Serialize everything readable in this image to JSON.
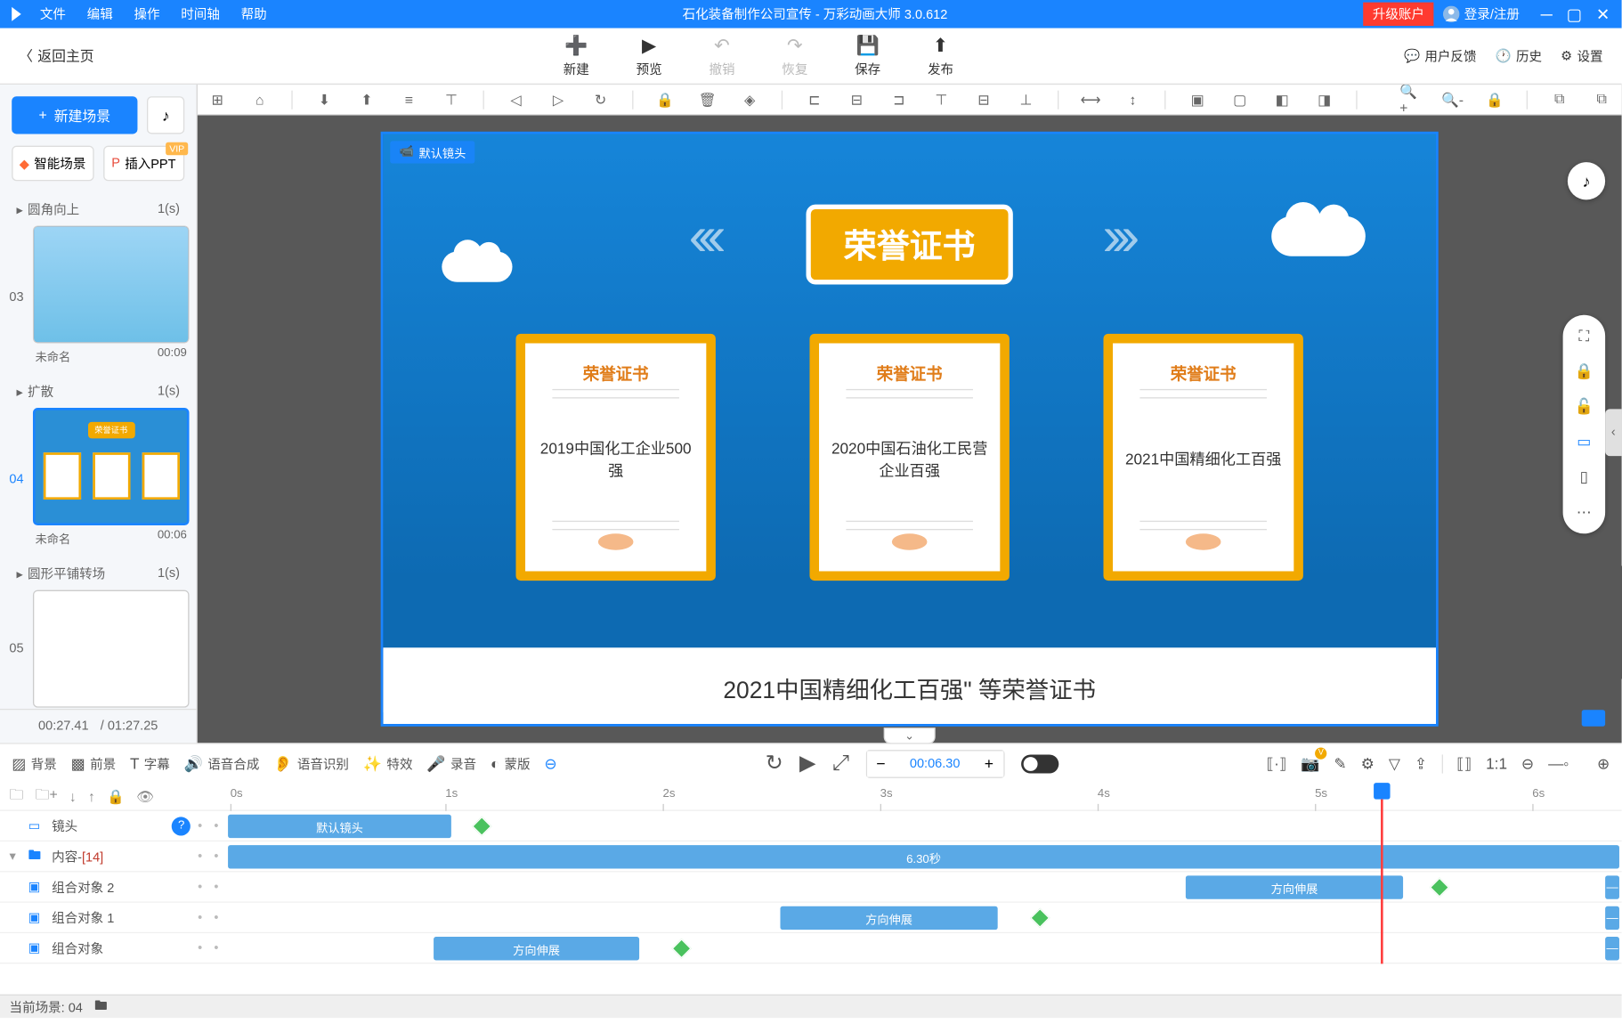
{
  "menu": {
    "file": "文件",
    "edit": "编辑",
    "action": "操作",
    "timeline": "时间轴",
    "help": "帮助"
  },
  "wintitle": "石化装备制作公司宣传 - 万彩动画大师 3.0.612",
  "upgrade": "升级账户",
  "login": "登录/注册",
  "back": "返回主页",
  "mainactions": {
    "new": "新建",
    "preview": "预览",
    "undo": "撤销",
    "redo": "恢复",
    "save": "保存",
    "publish": "发布"
  },
  "rightlinks": {
    "feedback": "用户反馈",
    "history": "历史",
    "settings": "设置"
  },
  "sidebar": {
    "newscene": "新建场景",
    "aiscene": "智能场景",
    "insertppt": "插入PPT",
    "vip": "VIP",
    "transitions": {
      "t1": "圆角向上",
      "t1d": "1(s)",
      "t2": "扩散",
      "t2d": "1(s)",
      "t3": "圆形平铺转场",
      "t3d": "1(s)"
    },
    "scenes": {
      "s3": {
        "num": "03",
        "name": "未命名",
        "dur": "00:09"
      },
      "s4": {
        "num": "04",
        "name": "未命名",
        "dur": "00:06"
      },
      "s5": {
        "num": "05"
      }
    },
    "time_current": "00:27.41",
    "time_total": "/ 01:27.25"
  },
  "canvas": {
    "label": "默认镜头",
    "title": "荣誉证书",
    "cert_header": "荣誉证书",
    "cert1": "2019中国化工企业500强",
    "cert2": "2020中国石油化工民营企业百强",
    "cert3": "2021中国精细化工百强",
    "subtitle": "2021中国精细化工百强\" 等荣誉证书"
  },
  "bottombar": {
    "bg": "背景",
    "fg": "前景",
    "subtitle": "字幕",
    "tts": "语音合成",
    "asr": "语音识别",
    "fx": "特效",
    "record": "录音",
    "mask": "蒙版",
    "time": "00:06.30"
  },
  "timeline": {
    "ticks": [
      "0s",
      "1s",
      "2s",
      "3s",
      "4s",
      "5s",
      "6s"
    ],
    "rows": {
      "camera": "镜头",
      "content": "内容-",
      "content_count": "[14]",
      "g1": "组合对象 2",
      "g2": "组合对象 1",
      "g3": "组合对象"
    },
    "clips": {
      "defcam": "默认镜头",
      "duration": "6.30秒",
      "dir": "方向伸展"
    }
  },
  "status": "当前场景: 04"
}
